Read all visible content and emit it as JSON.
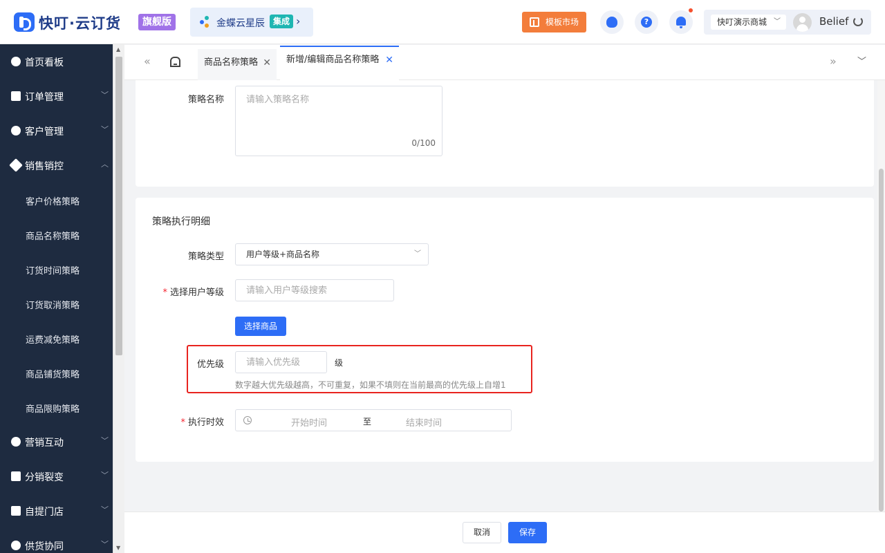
{
  "header": {
    "logo_text": "快叮·云订货",
    "edition_badge": "旗舰版",
    "kingdee_text": "金蝶云星辰",
    "kingdee_tag": "集成",
    "template_market": "模板市场",
    "help_symbol": "?",
    "store_selector": "快叮演示商城",
    "username": "Belief",
    "brand_color": "#2d6df6"
  },
  "sidebar": {
    "items": [
      {
        "label": "首页看板",
        "icon": "navigation-icon",
        "expandable": false
      },
      {
        "label": "订单管理",
        "icon": "clipboard-icon",
        "expandable": true,
        "expanded": false
      },
      {
        "label": "客户管理",
        "icon": "user-icon",
        "expandable": true,
        "expanded": false
      },
      {
        "label": "销售销控",
        "icon": "tag-icon",
        "expandable": true,
        "expanded": true
      },
      {
        "label": "客户价格策略",
        "sub": true
      },
      {
        "label": "商品名称策略",
        "sub": true
      },
      {
        "label": "订货时间策略",
        "sub": true
      },
      {
        "label": "订货取消策略",
        "sub": true
      },
      {
        "label": "运费减免策略",
        "sub": true
      },
      {
        "label": "商品铺货策略",
        "sub": true
      },
      {
        "label": "商品限购策略",
        "sub": true
      },
      {
        "label": "营销互动",
        "icon": "target-icon",
        "expandable": true,
        "expanded": false
      },
      {
        "label": "分销裂变",
        "icon": "org-tree-icon",
        "expandable": true,
        "expanded": false
      },
      {
        "label": "自提门店",
        "icon": "store-icon",
        "expandable": true,
        "expanded": false
      },
      {
        "label": "供货协同",
        "icon": "link-icon",
        "expandable": true,
        "expanded": false
      }
    ]
  },
  "tabs": [
    {
      "label": "商品名称策略",
      "active": false
    },
    {
      "label": "新增/编辑商品名称策略",
      "active": true
    }
  ],
  "form": {
    "strategy_name_label": "策略名称",
    "strategy_name_placeholder": "请输入策略名称",
    "strategy_name_counter": "0/100",
    "section_title": "策略执行明细",
    "strategy_type_label": "策略类型",
    "strategy_type_value": "用户等级+商品名称",
    "user_level_label": "选择用户等级",
    "user_level_placeholder": "请输入用户等级搜索",
    "select_goods_button": "选择商品",
    "priority_label": "优先级",
    "priority_placeholder": "请输入优先级",
    "priority_unit": "级",
    "priority_hint": "数字越大优先级越高，不可重复，如果不填则在当前最高的优先级上自增1",
    "exec_time_label": "执行时效",
    "start_time_placeholder": "开始时间",
    "range_separator": "至",
    "end_time_placeholder": "结束时间",
    "required_mark": "*"
  },
  "footer": {
    "cancel": "取消",
    "save": "保存"
  }
}
